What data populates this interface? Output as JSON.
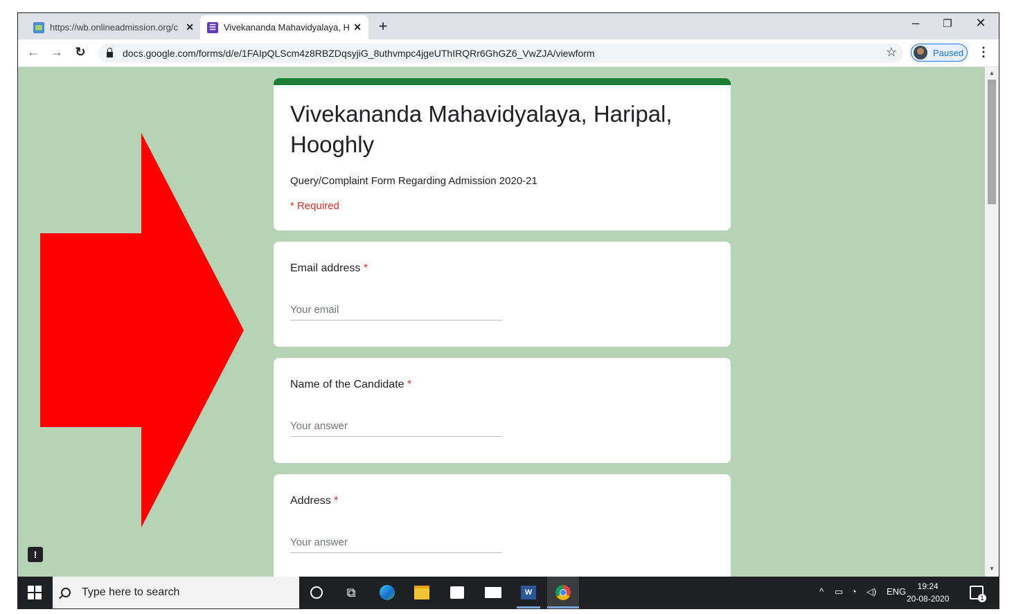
{
  "browser": {
    "tabs": [
      {
        "title": "https://wb.onlineadmission.org/c",
        "favicon": "admission-site-icon",
        "active": false
      },
      {
        "title": "Vivekananda Mahavidyalaya, Har",
        "favicon": "google-forms-icon",
        "active": true
      }
    ],
    "new_tab": "+",
    "url": "docs.google.com/forms/d/e/1FAIpQLScm4z8RBZDqsyjiG_8uthvmpc4jgeUThIRQRr6GhGZ6_VwZJA/viewform",
    "profile_status": "Paused",
    "window_controls": {
      "minimize": "–",
      "restore": "❐",
      "close": "✕"
    }
  },
  "form": {
    "title": "Vivekananda Mahavidyalaya, Haripal, Hooghly",
    "description": "Query/Complaint Form Regarding Admission 2020-21",
    "required_note": "* Required",
    "accent_color": "#1e7e34",
    "questions": [
      {
        "label": "Email address",
        "required_mark": "*",
        "placeholder": "Your email"
      },
      {
        "label": "Name of the Candidate",
        "required_mark": "*",
        "placeholder": "Your answer"
      },
      {
        "label": "Address",
        "required_mark": "*",
        "placeholder": "Your answer"
      }
    ]
  },
  "annotation": {
    "shape": "arrow-right",
    "color": "#ff0000"
  },
  "taskbar": {
    "search_placeholder": "Type here to search",
    "language": "ENG",
    "time": "19:24",
    "date": "20-08-2020",
    "notification_count": "1",
    "pinned_apps": [
      "cortana",
      "task-view",
      "edge",
      "file-explorer",
      "store",
      "mail",
      "word",
      "chrome"
    ]
  }
}
